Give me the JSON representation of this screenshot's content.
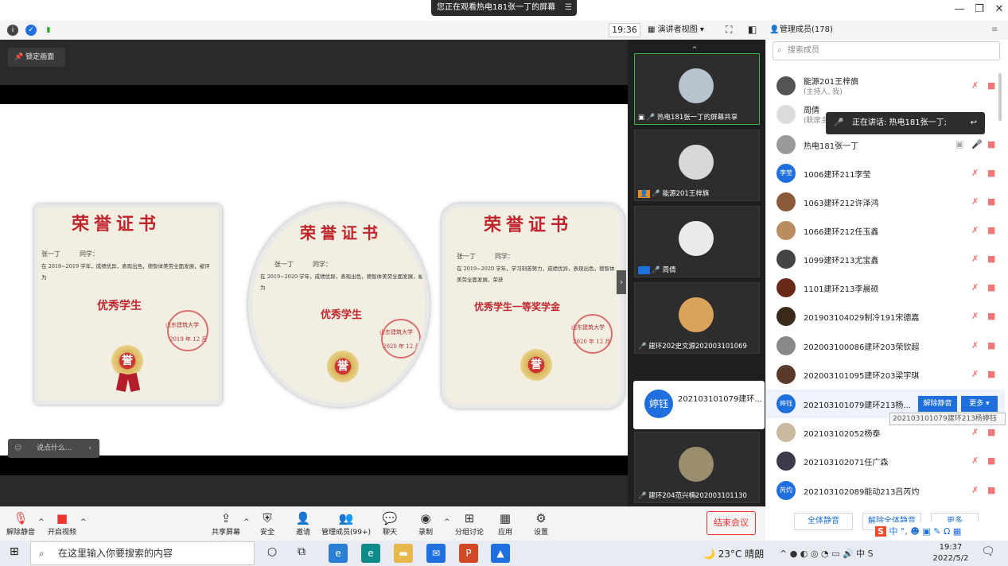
{
  "title_bar": {
    "share_banner": "您正在观看热电181张一丁的屏幕",
    "min": "—",
    "restore": "❐",
    "close": "✕"
  },
  "top_toolbar": {
    "time": "19:36",
    "view_label": "演讲者视图",
    "panel_title": "管理成员(178)"
  },
  "main": {
    "lock_label": "锁定画面",
    "chat_placeholder": "说点什么...",
    "certificates": [
      {
        "title": "荣誉证书",
        "name": "张一丁",
        "suffix": "同学：",
        "body": "在 2018~2019 学年，成绩优异，表现出色，德智体美劳全面发展，被评为",
        "award": "优秀学生",
        "school": "山东建筑大学",
        "date": "2019 年 12 月"
      },
      {
        "title": "荣誉证书",
        "name": "张一丁",
        "suffix": "同学：",
        "body": "在 2019~2020 学年，成绩优异，表现出色，德智体美劳全面发展，被评为",
        "award": "优秀学生",
        "school": "山东建筑大学",
        "date": "2020 年 12 月"
      },
      {
        "title": "荣誉证书",
        "name": "张一丁",
        "suffix": "同学：",
        "body": "在 2019~2020 学年，学习刻苦努力，成绩优异，表现出色，德智体美劳全面发展，荣获",
        "award": "优秀学生一等奖学金",
        "school": "山东建筑大学",
        "date": "2020 年 12 月"
      }
    ],
    "medal_char": "誉"
  },
  "video_tiles": [
    {
      "name": "热电181张一丁的屏幕共享"
    },
    {
      "name": "能源201王梓旗"
    },
    {
      "name": "周倩"
    },
    {
      "name": "建环202史文源202003101069"
    },
    {
      "name": "建环204范兴楠202003101130"
    }
  ],
  "popup": {
    "avatar": "婷钰",
    "name": "202103101079建环..."
  },
  "participants": {
    "search_placeholder": "搜索成员",
    "speaking": "正在讲话: 热电181张一丁;",
    "list": [
      {
        "name": "能源201王梓旗",
        "sub": "(主持人, 我)",
        "avatar": ""
      },
      {
        "name": "周倩",
        "sub": "(联席主",
        "avatar": ""
      },
      {
        "name": "热电181张一丁",
        "sub": "",
        "avatar": ""
      },
      {
        "name": "1006建环211李莹",
        "sub": "",
        "avatar": "李莹"
      },
      {
        "name": "1063建环212许泽鸿",
        "sub": "",
        "avatar": ""
      },
      {
        "name": "1066建环212任玉鑫",
        "sub": "",
        "avatar": ""
      },
      {
        "name": "1099建环213尤宝鑫",
        "sub": "",
        "avatar": ""
      },
      {
        "name": "1101建环213李晨硕",
        "sub": "",
        "avatar": ""
      },
      {
        "name": "201903104029制冷191宋德嘉",
        "sub": "",
        "avatar": ""
      },
      {
        "name": "202003100086建环203荣钦超",
        "sub": "",
        "avatar": ""
      },
      {
        "name": "202003101095建环203梁宇琪",
        "sub": "",
        "avatar": ""
      },
      {
        "name": "202103101079建环213杨...",
        "sub": "",
        "avatar": "婷钰"
      },
      {
        "name": "202103102052杨泰",
        "sub": "",
        "avatar": ""
      },
      {
        "name": "202103102071任广森",
        "sub": "",
        "avatar": ""
      },
      {
        "name": "202103102089能动213吕芮灼",
        "sub": "",
        "avatar": "芮灼"
      }
    ],
    "unmute_label": "解除静音",
    "more_label": "更多 ▾",
    "tooltip": "202103101079建环213杨婷钰",
    "btn_mute_all": "全体静音",
    "btn_unmute_all": "解除全体静音",
    "btn_more": "更多"
  },
  "bottom_toolbar": {
    "items": [
      {
        "label": "解除静音"
      },
      {
        "label": "开启视频"
      },
      {
        "label": "共享屏幕"
      },
      {
        "label": "安全"
      },
      {
        "label": "邀请"
      },
      {
        "label": "管理成员(99+)"
      },
      {
        "label": "聊天"
      },
      {
        "label": "录制"
      },
      {
        "label": "分组讨论"
      },
      {
        "label": "应用"
      },
      {
        "label": "设置"
      }
    ],
    "end_label": "结束会议"
  },
  "ime": {
    "text": "中 °, ☻ ▣ ✎ Ω ▦"
  },
  "taskbar": {
    "search_placeholder": "在这里输入你要搜索的内容",
    "weather": "23°C 晴朗",
    "time": "19:37",
    "date": "2022/5/2"
  },
  "colors": {
    "accent": "#1f6fde",
    "danger": "#e33333",
    "cert_red": "#c0252d"
  }
}
